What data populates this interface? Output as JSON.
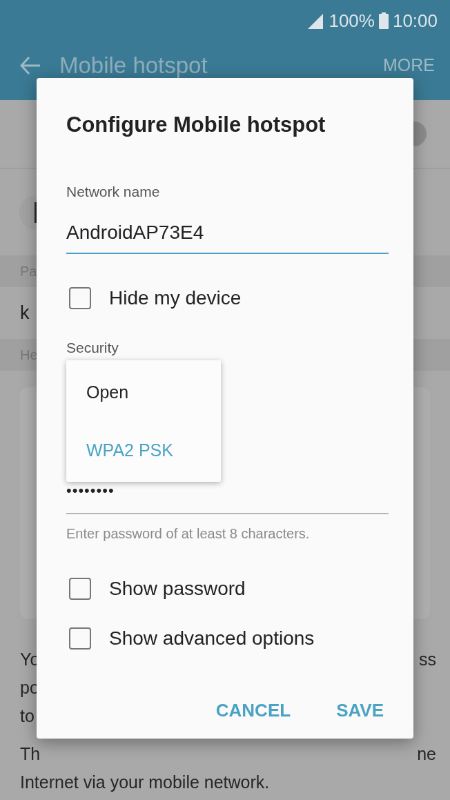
{
  "status_bar": {
    "battery": "100%",
    "time": "10:00"
  },
  "app_bar": {
    "title": "Mobile hotspot",
    "action": "MORE"
  },
  "background": {
    "switch": {
      "on": false
    },
    "section_1": "Pa",
    "row_text": "k",
    "section_2": "He",
    "paragraph_lines": [
      {
        "left": "Yo",
        "right": "ss"
      },
      {
        "left": "po"
      },
      {
        "left": "to"
      },
      {
        "left": "Th",
        "right": "ne"
      },
      {
        "left": "Internet via your mobile network."
      }
    ]
  },
  "dialog": {
    "title": "Configure Mobile hotspot",
    "network_label": "Network name",
    "network_value": "AndroidAP73E4",
    "hide_device": {
      "label": "Hide my device",
      "checked": false
    },
    "security_label": "Security",
    "security_menu": [
      {
        "label": "Open",
        "selected": false
      },
      {
        "label": "WPA2 PSK",
        "selected": true
      }
    ],
    "password_value": "••••••••",
    "password_hint": "Enter password of at least 8 characters.",
    "options": [
      {
        "label": "Show password",
        "checked": false
      },
      {
        "label": "Show advanced options",
        "checked": false
      }
    ],
    "buttons": [
      "CANCEL",
      "SAVE"
    ]
  }
}
